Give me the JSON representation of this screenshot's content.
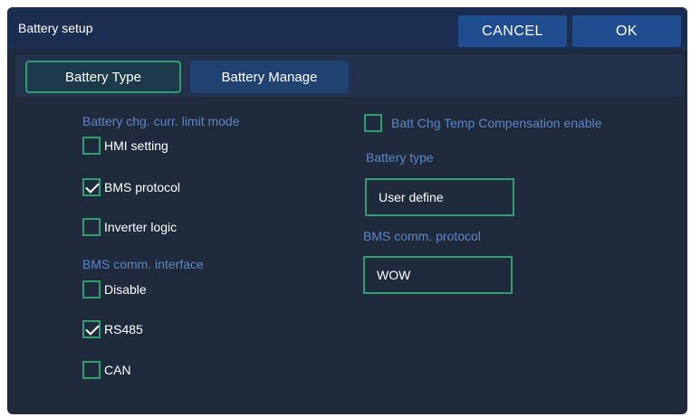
{
  "header": {
    "title": "Battery setup",
    "cancel_label": "CANCEL",
    "ok_label": "OK"
  },
  "tabs": [
    {
      "label": "Battery Type",
      "active": true
    },
    {
      "label": "Battery Manage",
      "active": false
    }
  ],
  "left": {
    "limit_mode": {
      "label": "Battery chg. curr. limit mode",
      "options": [
        {
          "label": "HMI setting",
          "checked": false
        },
        {
          "label": "BMS protocol",
          "checked": true
        },
        {
          "label": "Inverter logic",
          "checked": false
        }
      ]
    },
    "interface": {
      "label": "BMS comm. interface",
      "options": [
        {
          "label": "Disable",
          "checked": false
        },
        {
          "label": "RS485",
          "checked": true
        },
        {
          "label": "CAN",
          "checked": false
        }
      ]
    }
  },
  "right": {
    "temp_comp": {
      "label": "Batt Chg Temp Compensation enable",
      "checked": false
    },
    "battery_type": {
      "label": "Battery type",
      "value": "User define"
    },
    "bms_protocol": {
      "label": "BMS comm. protocol",
      "value": "WOW"
    }
  },
  "colors": {
    "accent": "#2f9e6e",
    "section_label": "#5c86c4",
    "header_button": "#1f4d8f",
    "background": "#1f2a3d"
  }
}
